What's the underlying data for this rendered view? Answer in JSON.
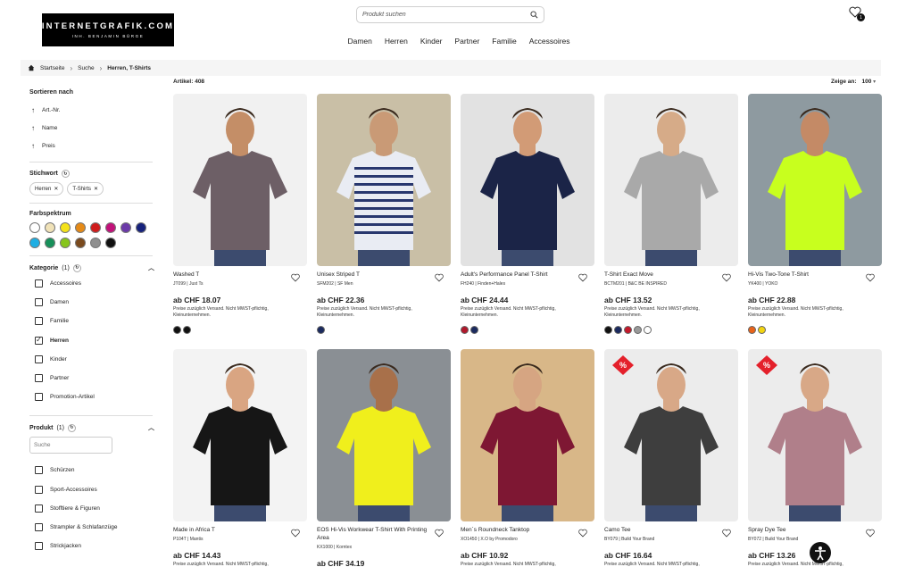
{
  "header": {
    "logo_line1": "INTERNETGRAFIK.COM",
    "logo_line2": "INH. BENJAMIN BÜRGE",
    "search_placeholder": "Produkt suchen",
    "wishlist_count": "1",
    "nav": [
      "Damen",
      "Herren",
      "Kinder",
      "Partner",
      "Familie",
      "Accessoires"
    ]
  },
  "breadcrumb": [
    "Startseite",
    "Suche",
    "Herren, T-Shirts"
  ],
  "toolbar": {
    "articles": "Artikel: 408",
    "show_label": "Zeige an:",
    "show_value": "100"
  },
  "sidebar": {
    "sort_title": "Sortieren nach",
    "sort_items": [
      "Art.-Nr.",
      "Name",
      "Preis"
    ],
    "keyword_title": "Stichwort",
    "keywords": [
      "Herren",
      "T-Shirts"
    ],
    "color_title": "Farbspektrum",
    "colors": [
      "#ffffff",
      "#f0e2b8",
      "#f4e21a",
      "#e58a17",
      "#cf1c1c",
      "#c2127a",
      "#6b3aa8",
      "#16227c",
      "#1eaee3",
      "#17905a",
      "#86c51c",
      "#7a4a1e",
      "#8f8f8f",
      "#111111"
    ],
    "category_title": "Kategorie",
    "category_count": "(1)",
    "categories": [
      {
        "label": "Accessoires",
        "checked": false
      },
      {
        "label": "Damen",
        "checked": false
      },
      {
        "label": "Familie",
        "checked": false
      },
      {
        "label": "Herren",
        "checked": true
      },
      {
        "label": "Kinder",
        "checked": false
      },
      {
        "label": "Partner",
        "checked": false
      },
      {
        "label": "Promotion-Artikel",
        "checked": false
      }
    ],
    "product_title": "Produkt",
    "product_count": "(1)",
    "product_search_placeholder": "Suche",
    "products": [
      "Schürzen",
      "Sport-Accessoires",
      "Stofftiere & Figuren",
      "Strampler & Schlafanzüge",
      "Strickjacken"
    ]
  },
  "price_note": "Preise zuzüglich Versand. Nicht MWST-pflichtig, Kleinunternehmen.",
  "products": [
    {
      "name": "Washed T",
      "sku": "JT099 | Just Ts",
      "price": "ab CHF 18.07",
      "bg": "#f1f1f1",
      "shirt": "#6d5f66",
      "skin": "#c48e67",
      "colors": [
        "#111111",
        "#111111"
      ],
      "sale": false
    },
    {
      "name": "Unisex Striped T",
      "sku": "SFM202 | SF Men",
      "price": "ab CHF 22.36",
      "bg": "#c9bfa6",
      "shirt": "#e9ecf3",
      "skin": "#c99a76",
      "stripe": "#28376e",
      "colors": [
        "#1b2a5e"
      ],
      "sale": false
    },
    {
      "name": "Adult's Performance Panel T-Shirt",
      "sku": "FH240 | Finden+Hales",
      "price": "ab CHF 24.44",
      "bg": "#e2e2e2",
      "shirt": "#1b2447",
      "skin": "#d29b76",
      "colors": [
        "#b0182c",
        "#1b2a5e"
      ],
      "sale": false
    },
    {
      "name": "T-Shirt Exact Move",
      "sku": "BCTM201 | B&C BE INSPIRED",
      "price": "ab CHF 13.52",
      "bg": "#ececec",
      "shirt": "#a9a9a9",
      "skin": "#d6ab88",
      "colors": [
        "#111111",
        "#1b2a5e",
        "#c31a2b",
        "#999999",
        "#ffffff"
      ],
      "sale": false
    },
    {
      "name": "Hi-Vis Two-Tone T-Shirt",
      "sku": "YK400 | YOKO",
      "price": "ab CHF 22.88",
      "bg": "#8e9aa0",
      "shirt": "#c8ff1e",
      "skin": "#c48a66",
      "colors": [
        "#e8631a",
        "#f2d411"
      ],
      "sale": false
    },
    {
      "name": "Made in Africa T",
      "sku": "P104T | Mantis",
      "price": "ab CHF 14.43",
      "bg": "#f3f3f3",
      "shirt": "#161616",
      "skin": "#d9a582",
      "colors": [],
      "sale": false
    },
    {
      "name": "EOS Hi-Vis Workwear T-Shirt With Printing Area",
      "sku": "KX1000 | Korntex",
      "price": "ab CHF 34.19",
      "bg": "#8a8f94",
      "shirt": "#f0ef1c",
      "skin": "#a8704a",
      "colors": [],
      "sale": false
    },
    {
      "name": "Men´s Roundneck Tanktop",
      "sku": "XO1450 | X.O by Promodoro",
      "price": "ab CHF 10.92",
      "bg": "#d8b788",
      "shirt": "#7e1733",
      "skin": "#d6a582",
      "colors": [],
      "sale": false
    },
    {
      "name": "Camo Tee",
      "sku": "BY079 | Build Your Brand",
      "price": "ab CHF 16.64",
      "bg": "#ececec",
      "shirt": "#3e3e3e",
      "skin": "#d8a887",
      "colors": [],
      "sale": true
    },
    {
      "name": "Spray Dye Tee",
      "sku": "BY072 | Build Your Brand",
      "price": "ab CHF 13.26",
      "bg": "#ececec",
      "shirt": "#b07f8a",
      "skin": "#d8a887",
      "colors": [],
      "sale": true
    }
  ]
}
